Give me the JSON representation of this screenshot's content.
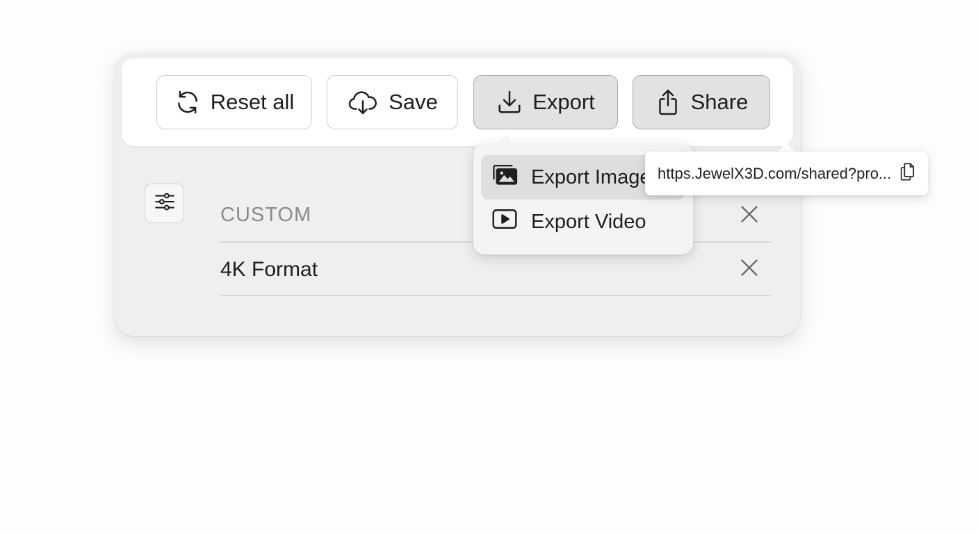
{
  "toolbar": {
    "reset_label": "Reset all",
    "save_label": "Save",
    "export_label": "Export",
    "share_label": "Share",
    "icons": {
      "reset": "refresh-icon",
      "save": "cloud-download-icon",
      "export": "download-icon",
      "share": "share-icon"
    }
  },
  "export_menu": {
    "items": [
      {
        "label": "Export Image",
        "icon": "image-stack-icon",
        "highlighted": true
      },
      {
        "label": "Export Video",
        "icon": "play-icon",
        "highlighted": false
      }
    ]
  },
  "share_popover": {
    "url": "https.JewelX3D.com/shared?pro...",
    "copy_icon": "copy-icon"
  },
  "presets": {
    "filter_icon": "sliders-icon",
    "rows": [
      {
        "label": "CUSTOM",
        "remove_icon": "close-icon"
      },
      {
        "label": "4K Format",
        "remove_icon": "close-icon"
      }
    ]
  },
  "colors": {
    "panel_bg": "#efefed",
    "toolbar_bg": "#ffffff",
    "active_button_bg": "#e2e2e0",
    "muted_text": "#8b8b8b"
  }
}
